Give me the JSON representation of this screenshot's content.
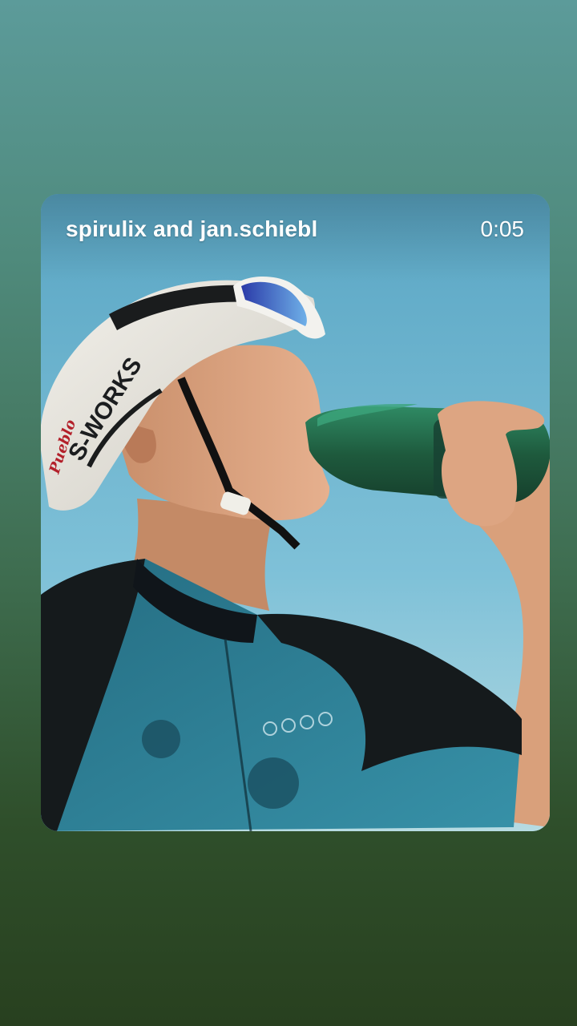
{
  "story": {
    "author_line": "spirulix and jan.schiebl",
    "elapsed_time": "0:05"
  },
  "media": {
    "helmet_text": "S-WORKS",
    "helmet_sticker_text": "Pueblo",
    "jersey_icons": [
      "drop-icon",
      "spiral-icon",
      "waves-icon",
      "leaf-icon"
    ]
  },
  "colors": {
    "sky": "#7cc0d8",
    "jersey_teal": "#2f7e93",
    "jersey_black": "#151a1c",
    "bottle_green": "#1f5e3f",
    "background_top": "#5c9b9a",
    "background_bottom": "#28401f"
  }
}
